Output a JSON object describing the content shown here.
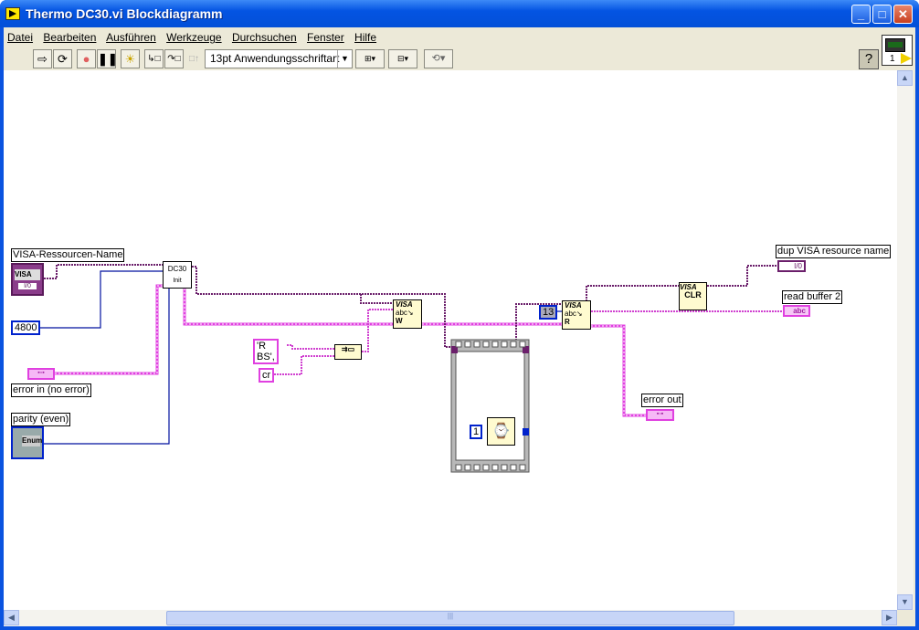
{
  "window": {
    "title": "Thermo DC30.vi Blockdiagramm"
  },
  "menu": [
    "Datei",
    "Bearbeiten",
    "Ausführen",
    "Werkzeuge",
    "Durchsuchen",
    "Fenster",
    "Hilfe"
  ],
  "toolbar": {
    "font": "13pt Anwendungsschriftart",
    "connector_pane_number": "1",
    "help": "?"
  },
  "diagram": {
    "visa_control_label": "VISA-Ressourcen-Name",
    "visa_control_text": "VISA",
    "visa_control_sub": "I/0",
    "baud_const": "4800",
    "error_in_label": "error in (no error)",
    "parity_label": "parity (even)",
    "parity_text": "Enum",
    "subvi_line1": "DC30",
    "subvi_line2": "Init",
    "string_const": "'R BS',",
    "cr_const": "cr",
    "visa_write_title": "VISA",
    "visa_write_mode": "W",
    "wait_const": "1",
    "bytes_const": "13",
    "visa_read_title": "VISA",
    "visa_read_mode": "R",
    "visa_clr_title": "VISA",
    "visa_clr_text": "CLR",
    "dup_label": "dup VISA resource name",
    "dup_text": "I/0",
    "read_buffer_label": "read buffer 2",
    "read_buffer_text": "abc",
    "error_out_label": "error out"
  },
  "colors": {
    "titlebar": "#0454e2",
    "visa_wire": "#6b1f6b",
    "error_wire": "#e040e0",
    "numeric_wire": "#00129f",
    "string_wire": "#d040d0",
    "node_bg": "#fffbd0"
  }
}
